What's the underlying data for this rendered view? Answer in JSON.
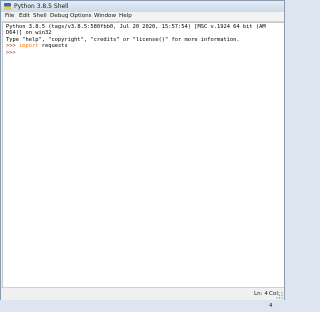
{
  "window": {
    "title": "Python 3.8.5 Shell"
  },
  "menu": [
    "File",
    "Edit",
    "Shell",
    "Debug",
    "Options",
    "Window",
    "Help"
  ],
  "shell": {
    "banner_1": "Python 3.8.5 (tags/v3.8.5:580fbb0, Jul 20 2020, 15:57:54) [MSC v.1924 64 bit (AM",
    "banner_2": "D64)] on win32",
    "banner_3": "Type \"help\", \"copyright\", \"credits\" or \"license()\" for more information.",
    "prompt": ">>>",
    "cmd_keyword": "import",
    "cmd_rest": " requests"
  },
  "status": {
    "line": "Ln: 4",
    "col": "Col: 4"
  },
  "colors": {
    "prompt": "#8b2e1f",
    "keyword": "#ff7700"
  }
}
